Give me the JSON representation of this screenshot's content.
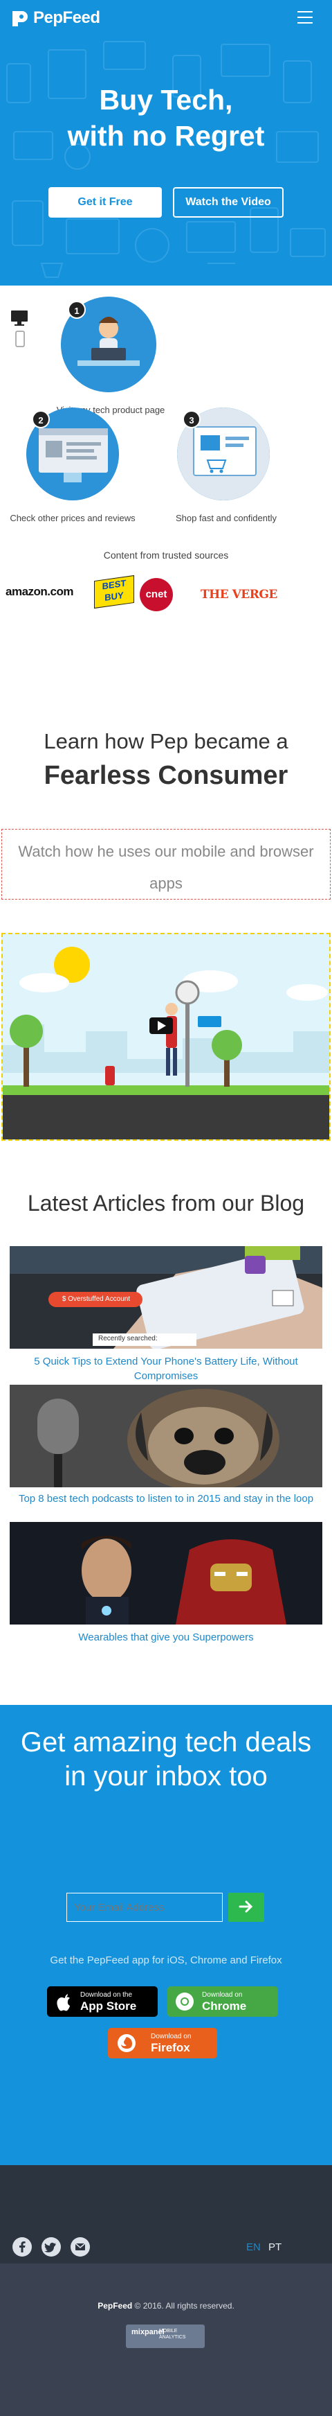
{
  "header": {
    "brand": "PepFeed"
  },
  "hero": {
    "title_line1": "Buy Tech,",
    "title_line2": "with no Regret",
    "cta_primary": "Get it Free",
    "cta_secondary": "Watch the Video"
  },
  "steps": [
    {
      "number": "1",
      "label": "Visit any tech product page"
    },
    {
      "number": "2",
      "label": "Check other prices and reviews"
    },
    {
      "number": "3",
      "label": "Shop fast and confidently"
    }
  ],
  "trusted": {
    "title": "Content from trusted sources",
    "sources": [
      "amazon.com",
      "BEST BUY",
      "cnet",
      "THE VERGE"
    ]
  },
  "learn": {
    "line1": "Learn how Pep became a",
    "line2": "Fearless Consumer",
    "watch_text": "Watch how he uses our mobile and browser apps"
  },
  "blog": {
    "title": "Latest Articles from our Blog",
    "overlay_tag": "$ Overstuffed Account",
    "overlay_search": "Recently searched:",
    "articles": [
      {
        "title": "5 Quick Tips to Extend Your Phone's Battery Life, Without Compromises"
      },
      {
        "title": "Top 8 best tech podcasts to listen to in 2015 and stay in the loop"
      },
      {
        "title": "Wearables that give you Superpowers"
      }
    ]
  },
  "newsletter": {
    "title": "Get amazing tech deals in your inbox too",
    "email_placeholder": "Your Email Address",
    "submit_icon": "arrow-right-icon",
    "apps_text": "Get the PepFeed app for iOS, Chrome and Firefox",
    "appstore_small": "Download on the",
    "appstore_big": "App Store",
    "chrome_small": "Download on",
    "chrome_big": "Chrome",
    "firefox_small": "Download on",
    "firefox_big": "Firefox"
  },
  "footer": {
    "social": [
      "facebook-icon",
      "twitter-icon",
      "email-icon"
    ],
    "lang_en": "EN",
    "lang_pt": "PT",
    "brand": "PepFeed",
    "copyright": "© 2016. All rights reserved.",
    "badge_logo": "mixpanel",
    "badge_line1": "MOBILE",
    "badge_line2": "ANALYTICS"
  },
  "colors": {
    "brand_blue": "#1592dc",
    "link_blue": "#1e88c8",
    "green": "#2db94d",
    "firefox_orange": "#e8601c",
    "footer_dark": "#2c3440"
  }
}
